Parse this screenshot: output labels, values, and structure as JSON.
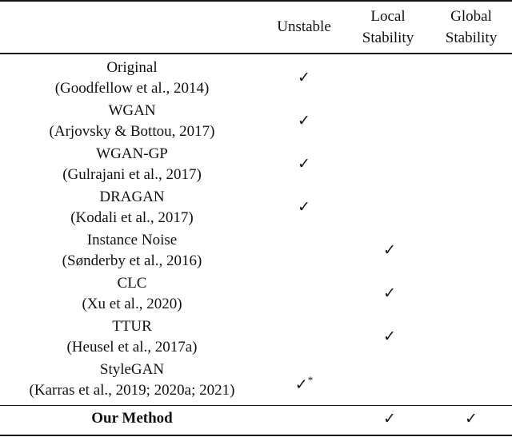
{
  "table": {
    "columns": [
      "Unstable",
      "Local Stability",
      "Global Stability"
    ],
    "columns_lines": [
      [
        "Unstable"
      ],
      [
        "Local",
        "Stability"
      ],
      [
        "Global",
        "Stability"
      ]
    ],
    "check_glyph": "✓",
    "rows": [
      {
        "name": "Original",
        "citation": "(Goodfellow et al., 2014)",
        "unstable": "✓",
        "local": "",
        "global": "",
        "note": ""
      },
      {
        "name": "WGAN",
        "citation": "(Arjovsky & Bottou, 2017)",
        "unstable": "✓",
        "local": "",
        "global": "",
        "note": ""
      },
      {
        "name": "WGAN-GP",
        "citation": "(Gulrajani et al., 2017)",
        "unstable": "✓",
        "local": "",
        "global": "",
        "note": ""
      },
      {
        "name": "DRAGAN",
        "citation": "(Kodali et al., 2017)",
        "unstable": "✓",
        "local": "",
        "global": "",
        "note": ""
      },
      {
        "name": "Instance Noise",
        "citation": "(Sønderby et al., 2016)",
        "unstable": "",
        "local": "✓",
        "global": "",
        "note": ""
      },
      {
        "name": "CLC",
        "citation": "(Xu et al., 2020)",
        "unstable": "",
        "local": "✓",
        "global": "",
        "note": ""
      },
      {
        "name": "TTUR",
        "citation": "(Heusel et al., 2017a)",
        "unstable": "",
        "local": "✓",
        "global": "",
        "note": ""
      },
      {
        "name": "StyleGAN",
        "citation": "(Karras et al., 2019; 2020a; 2021)",
        "unstable": "✓",
        "local": "",
        "global": "",
        "note": "*"
      }
    ],
    "ours": {
      "name": "Our Method",
      "unstable": "",
      "local": "✓",
      "global": "✓"
    }
  }
}
